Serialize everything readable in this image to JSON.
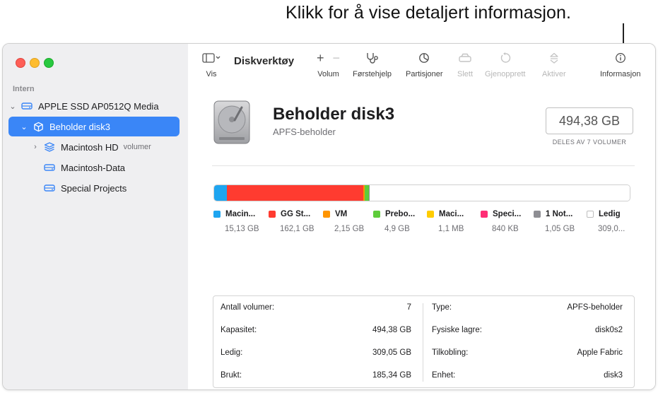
{
  "callout": {
    "text": "Klikk for å vise detaljert informasjon."
  },
  "sidebar": {
    "section_label": "Intern",
    "items": [
      {
        "label": "APPLE SSD AP0512Q Media",
        "icon": "drive-icon",
        "chevron": "⌄"
      },
      {
        "label": "Beholder disk3",
        "icon": "container-icon",
        "chevron": "⌄",
        "selected": true
      },
      {
        "label": "Macintosh HD",
        "icon": "layers-icon",
        "chevron": "›",
        "tag": "volumer"
      },
      {
        "label": "Macintosh-Data",
        "icon": "drive-icon"
      },
      {
        "label": "Special Projects",
        "icon": "drive-icon"
      }
    ]
  },
  "toolbar": {
    "view_label": "Vis",
    "title": "Diskverktøy",
    "volume_label": "Volum",
    "volume_add": "+",
    "volume_remove": "−",
    "firstaid_label": "Førstehjelp",
    "partition_label": "Partisjoner",
    "erase_label": "Slett",
    "restore_label": "Gjenopprett",
    "mount_label": "Aktiver",
    "info_label": "Informasjon"
  },
  "disk": {
    "name": "Beholder disk3",
    "subtitle": "APFS-beholder",
    "size": "494,38 GB",
    "shared_note": "DELES AV 7 VOLUMER"
  },
  "colors": {
    "accent": "#3a86f7",
    "segments": [
      "#1ea5f0",
      "#ff3b30",
      "#ff9500",
      "#5ecc3b",
      "#ffcc00",
      "#ff2d75",
      "#8e8e93",
      "#ffffff"
    ]
  },
  "usage": {
    "segments": [
      {
        "name": "Macin...",
        "value": "15,13 GB",
        "color": "#1ea5f0",
        "fraction": 0.0306
      },
      {
        "name": "GG St...",
        "value": "162,1 GB",
        "color": "#ff3b30",
        "fraction": 0.3279
      },
      {
        "name": "VM",
        "value": "2,15 GB",
        "color": "#ff9500",
        "fraction": 0.0043
      },
      {
        "name": "Prebo...",
        "value": "4,9 GB",
        "color": "#5ecc3b",
        "fraction": 0.0099
      },
      {
        "name": "Maci...",
        "value": "1,1 MB",
        "color": "#ffcc00",
        "fraction": 0.0
      },
      {
        "name": "Speci...",
        "value": "840 KB",
        "color": "#ff2d75",
        "fraction": 0.0
      },
      {
        "name": "1 Not...",
        "value": "1,05 GB",
        "color": "#8e8e93",
        "fraction": 0.0021
      },
      {
        "name": "Ledig",
        "value": "309,0...",
        "color": "#ffffff",
        "fraction": 0.6251
      }
    ]
  },
  "info": {
    "left": [
      {
        "key": "Antall volumer:",
        "value": "7"
      },
      {
        "key": "Kapasitet:",
        "value": "494,38 GB"
      },
      {
        "key": "Ledig:",
        "value": "309,05 GB"
      },
      {
        "key": "Brukt:",
        "value": "185,34 GB"
      }
    ],
    "right": [
      {
        "key": "Type:",
        "value": "APFS-beholder"
      },
      {
        "key": "Fysiske lagre:",
        "value": "disk0s2"
      },
      {
        "key": "Tilkobling:",
        "value": "Apple Fabric"
      },
      {
        "key": "Enhet:",
        "value": "disk3"
      }
    ]
  }
}
